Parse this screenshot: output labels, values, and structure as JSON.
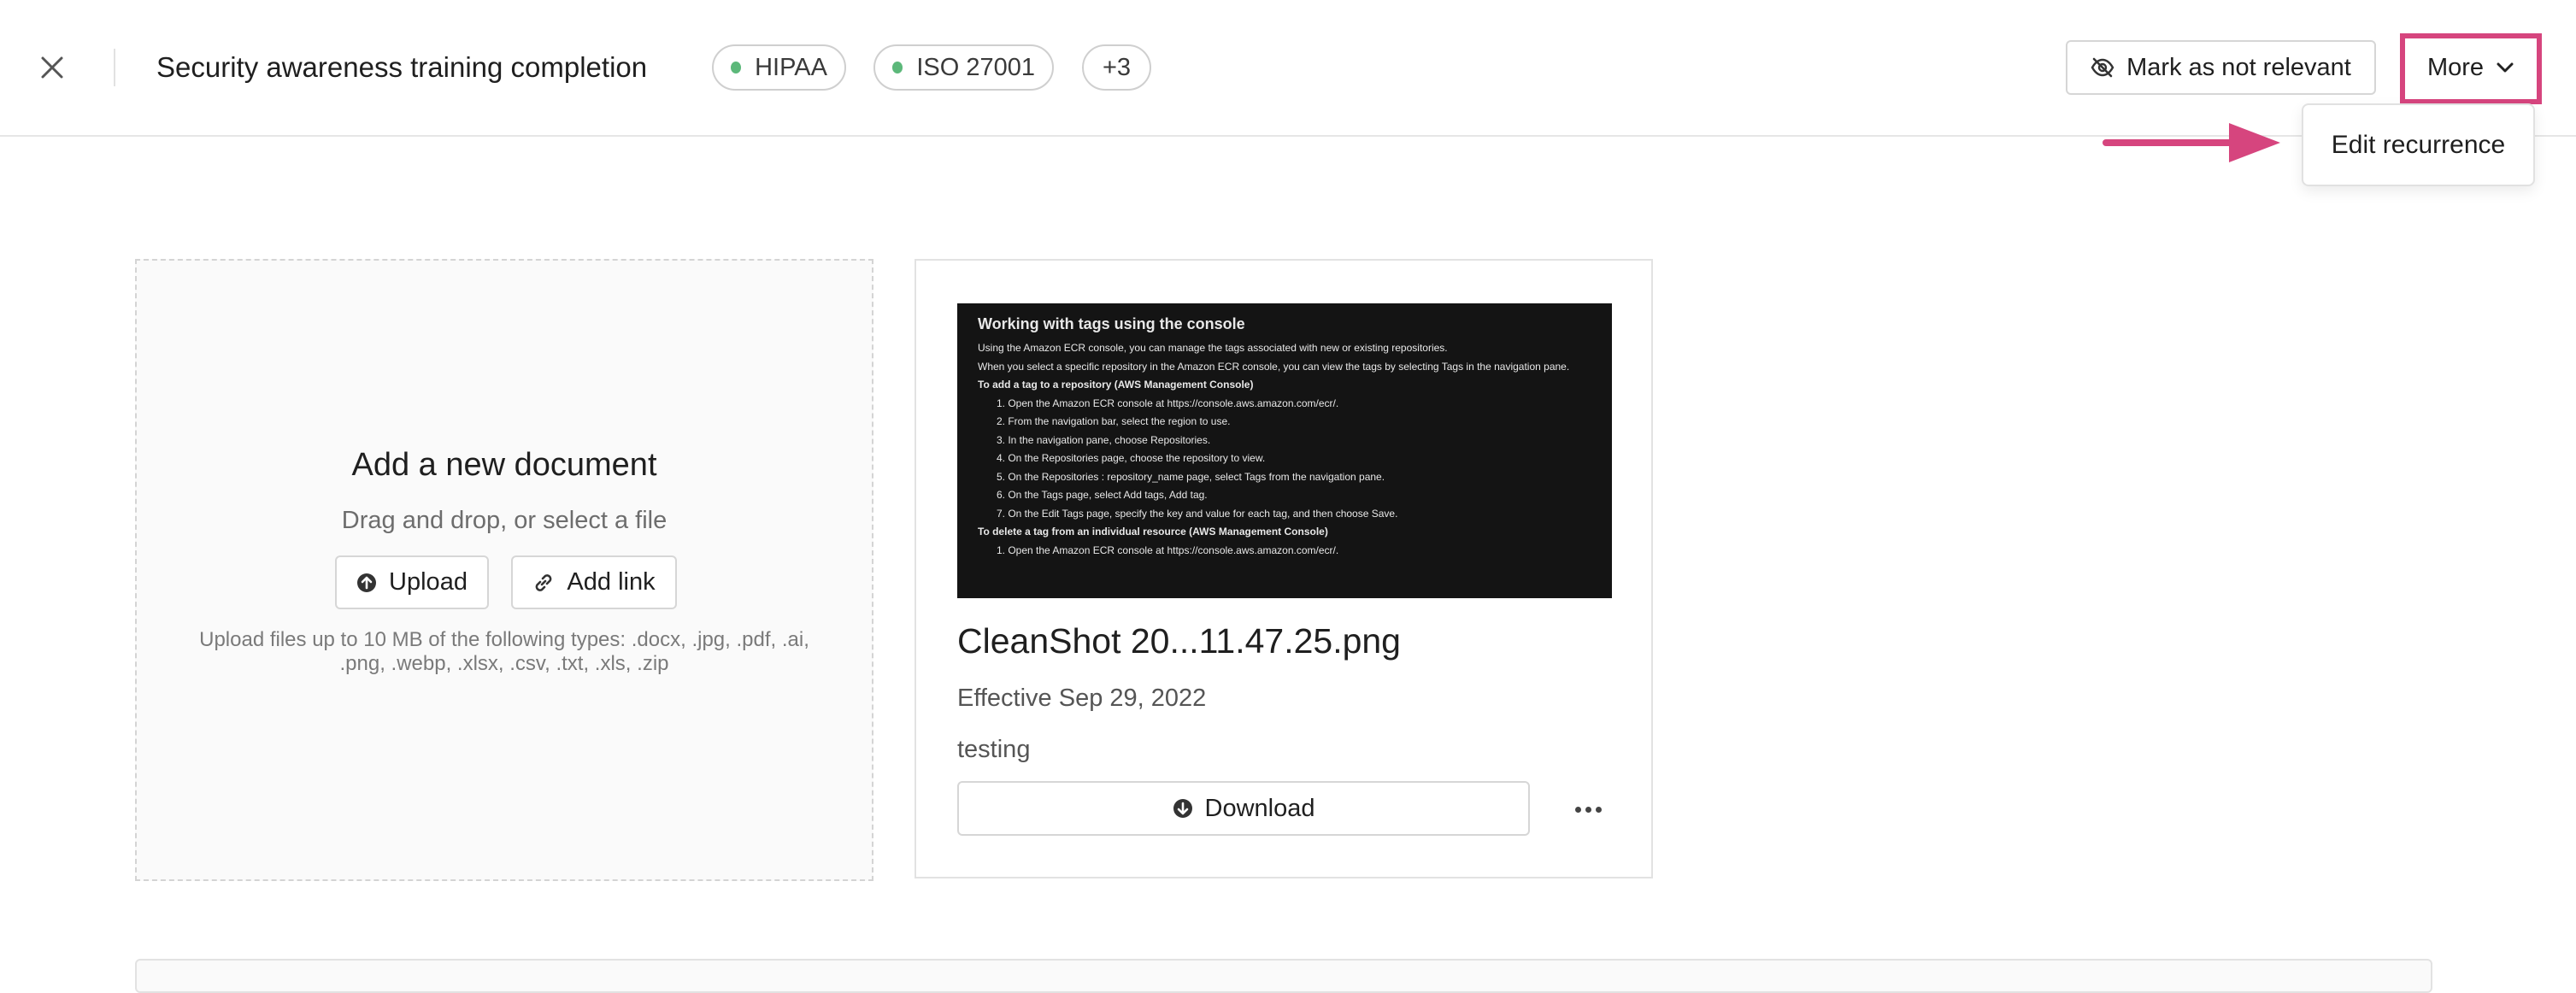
{
  "header": {
    "title": "Security awareness training completion",
    "chips": [
      {
        "label": "HIPAA",
        "dot_color": "#5cb87a"
      },
      {
        "label": "ISO 27001",
        "dot_color": "#5cb87a"
      },
      {
        "label": "+3"
      }
    ],
    "mark_not_relevant_label": "Mark as not relevant",
    "more_label": "More",
    "highlight_color": "#d6457e"
  },
  "more_menu": {
    "items": [
      {
        "label": "Edit recurrence"
      }
    ]
  },
  "upload": {
    "title": "Add a new document",
    "subtitle": "Drag and drop, or select a file",
    "upload_label": "Upload",
    "add_link_label": "Add link",
    "note": "Upload files up to 10 MB of the following types: .docx, .jpg, .pdf, .ai, .png, .webp, .xlsx, .csv, .txt, .xls, .zip"
  },
  "document": {
    "name": "CleanShot 20...11.47.25.png",
    "effective": "Effective Sep 29, 2022",
    "description": "testing",
    "download_label": "Download",
    "thumbnail": {
      "title": "Working with tags using the console",
      "p1": "Using the Amazon ECR console, you can manage the tags associated with new or existing repositories.",
      "p2": "When you select a specific repository in the Amazon ECR console, you can view the tags by selecting Tags in the navigation pane.",
      "h1": "To add a tag to a repository (AWS Management Console)",
      "steps": [
        "1. Open the Amazon ECR console at https://console.aws.amazon.com/ecr/.",
        "2. From the navigation bar, select the region to use.",
        "3. In the navigation pane, choose Repositories.",
        "4. On the Repositories page, choose the repository to view.",
        "5. On the Repositories : repository_name page, select Tags from the navigation pane.",
        "6. On the Tags page, select Add tags, Add tag.",
        "7. On the Edit Tags page, specify the key and value for each tag, and then choose Save."
      ],
      "h2": "To delete a tag from an individual resource (AWS Management Console)",
      "last": "1. Open the Amazon ECR console at https://console.aws.amazon.com/ecr/."
    }
  }
}
